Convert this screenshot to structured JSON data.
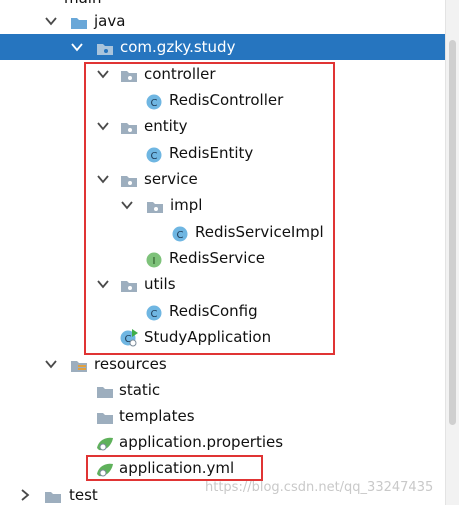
{
  "tree": {
    "top_partial": "main",
    "java": "java",
    "package": "com.gzky.study",
    "controller": "controller",
    "redis_controller": "RedisController",
    "entity": "entity",
    "redis_entity": "RedisEntity",
    "service": "service",
    "impl": "impl",
    "redis_service_impl": "RedisServiceImpl",
    "redis_service": "RedisService",
    "utils": "utils",
    "redis_config": "RedisConfig",
    "study_application": "StudyApplication",
    "resources": "resources",
    "static": "static",
    "templates": "templates",
    "app_properties": "application.properties",
    "app_yml": "application.yml",
    "test": "test"
  },
  "icon_badges": {
    "class": "C",
    "interface": "I"
  },
  "watermark": "https://blog.csdn.net/qq_33247435",
  "colors": {
    "selection": "#2675bf",
    "folder": "#8fa3b4",
    "class_badge": "#6fb6e2",
    "interface_badge": "#7ec27a",
    "highlight_box": "#e03434"
  }
}
